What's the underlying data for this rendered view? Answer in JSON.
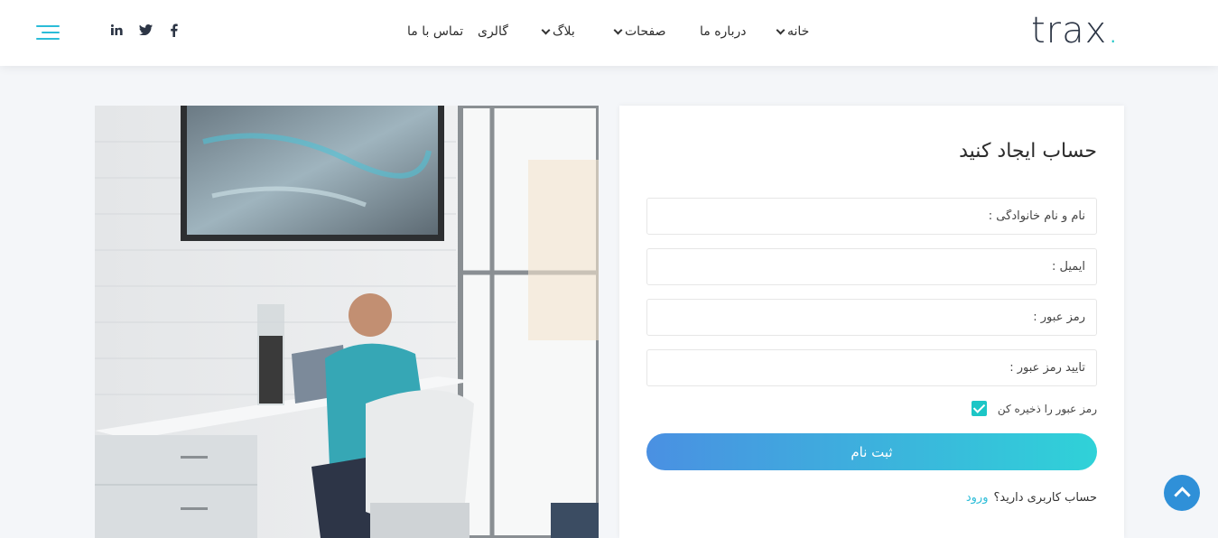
{
  "header": {
    "logo_text": "trax",
    "logo_dot": ".",
    "nav": {
      "home": "خانه",
      "about": "درباره ما",
      "pages": "صفحات",
      "blog": "بلاگ",
      "gallery": "گالری",
      "contact": "تماس با ما"
    },
    "social_icons": [
      "facebook-icon",
      "twitter-icon",
      "linkedin-icon"
    ],
    "menu_icon": "hamburger-menu-icon"
  },
  "form": {
    "title": "حساب ایجاد کنید",
    "fullname_placeholder": "نام و نام خانوادگی :",
    "email_placeholder": "ایمیل :",
    "password_placeholder": "رمز عبور :",
    "confirm_password_placeholder": "تایید رمز عبور :",
    "remember_label": "رمز عبور را ذخیره کن",
    "remember_checked": true,
    "submit_label": "ثبت نام",
    "have_account_text": "حساب کاربری دارید؟",
    "login_link": "ورود"
  },
  "colors": {
    "accent": "#1cc6c6",
    "button_gradient_start": "#2fd2d8",
    "button_gradient_end": "#4a90e2",
    "scroll_top": "#2f90d8"
  },
  "scroll_top_icon": "chevron-up-icon"
}
